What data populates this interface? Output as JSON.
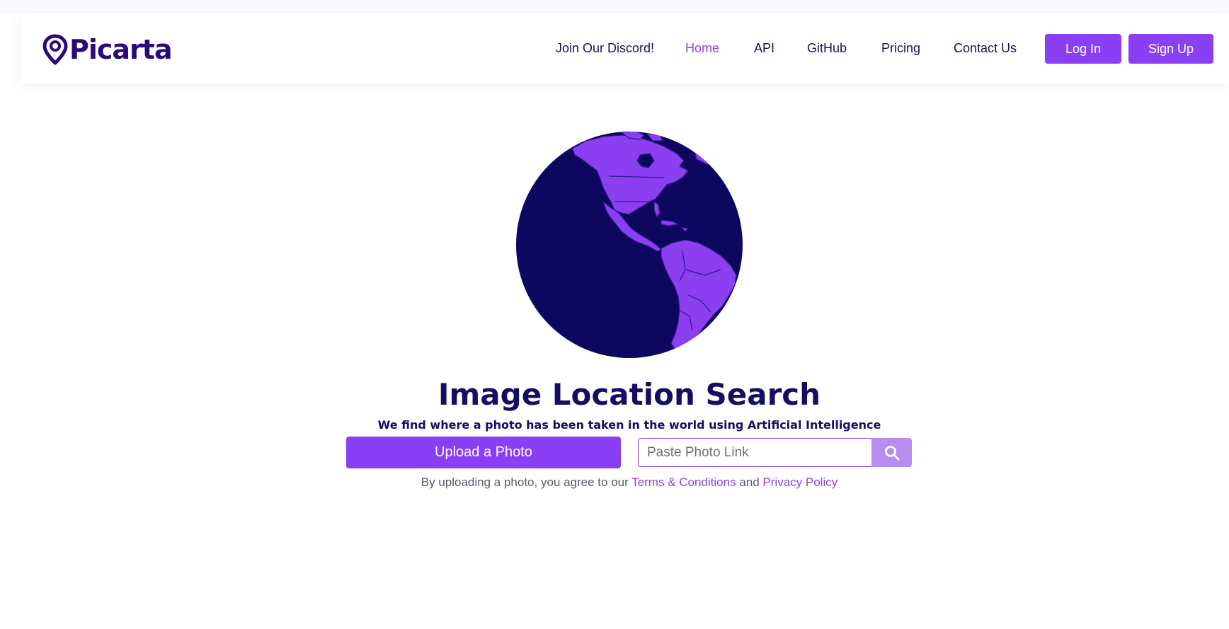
{
  "brand": {
    "name": "Picarta",
    "colors": {
      "primary": "#8a3ff5",
      "navy": "#140e63",
      "ocean": "#0d0760",
      "land": "#8b3ff0"
    }
  },
  "nav": {
    "links": [
      {
        "label": "Join Our Discord!",
        "active": false
      },
      {
        "label": "Home",
        "active": true
      },
      {
        "label": "API",
        "active": false
      },
      {
        "label": "GitHub",
        "active": false
      },
      {
        "label": "Pricing",
        "active": false
      },
      {
        "label": "Contact Us",
        "active": false
      }
    ],
    "login_label": "Log In",
    "signup_label": "Sign Up"
  },
  "hero": {
    "title": "Image Location Search",
    "subtitle": "We find where a photo has been taken in the world using Artificial Intelligence",
    "upload_label": "Upload a Photo",
    "link_placeholder": "Paste Photo Link",
    "search_icon": "search-icon",
    "globe_icon": "globe-americas-illustration"
  },
  "legal": {
    "prefix": "By uploading a photo, you agree to our",
    "terms_label": "Terms & Conditions",
    "and": "and",
    "privacy_label": "Privacy Policy"
  }
}
